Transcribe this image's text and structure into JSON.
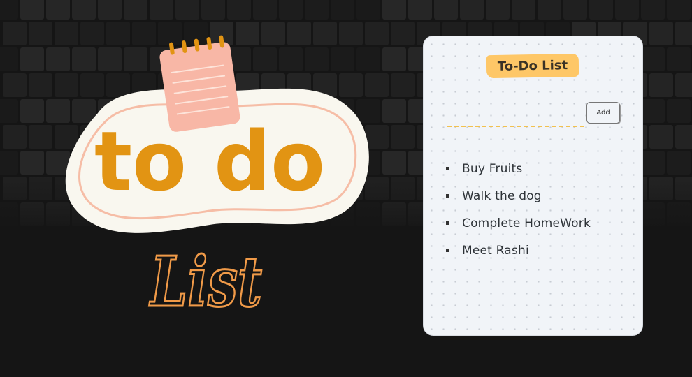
{
  "hero": {
    "word_top": "to do",
    "word_bottom": "List"
  },
  "todo": {
    "title": "To-Do List",
    "input_placeholder": "",
    "add_label": "Add",
    "items": [
      {
        "text": "Buy Fruits"
      },
      {
        "text": "Walk the dog"
      },
      {
        "text": "Complete HomeWork"
      },
      {
        "text": "Meet Rashi"
      }
    ]
  },
  "colors": {
    "accent_orange": "#e29413",
    "title_yellow": "#fec767",
    "outline_orange": "#f09a48",
    "notepad_pink": "#f8b7a6",
    "card_bg": "#f1f4f8",
    "page_bg": "#151515"
  }
}
